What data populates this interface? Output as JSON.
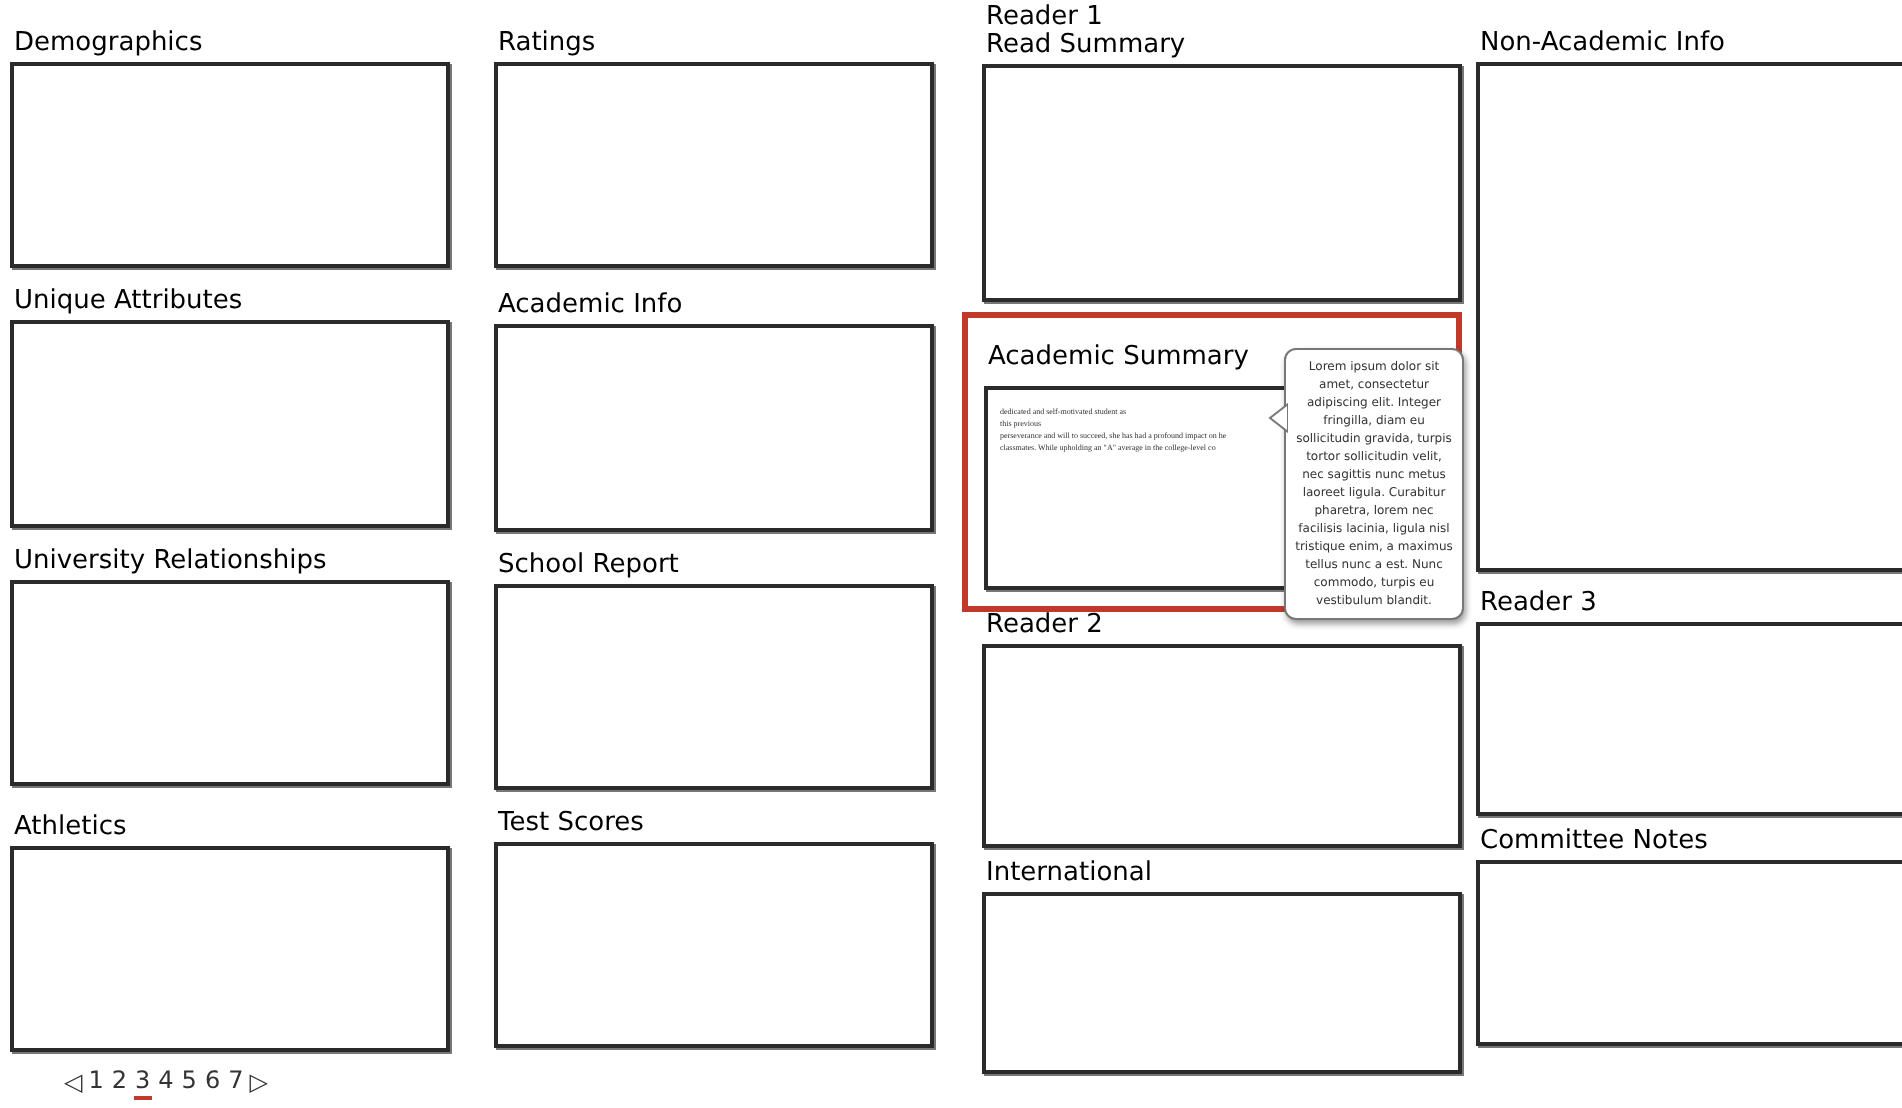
{
  "columns": [
    {
      "panels": [
        {
          "title": [
            "Demographics"
          ]
        },
        {
          "title": [
            "Unique Attributes"
          ]
        },
        {
          "title": [
            "University Relationships"
          ]
        },
        {
          "title": [
            "Athletics"
          ]
        }
      ]
    },
    {
      "panels": [
        {
          "title": [
            "Ratings"
          ]
        },
        {
          "title": [
            "Academic Info"
          ]
        },
        {
          "title": [
            "School Report"
          ]
        },
        {
          "title": [
            "Test Scores"
          ]
        }
      ]
    },
    {
      "panels": [
        {
          "title": [
            "Reader 1",
            "Read Summary"
          ]
        },
        {
          "title": [
            "Academic Summary"
          ],
          "selected": true,
          "snippet": [
            "dedicated and self-motivated student as",
            "this previous",
            "perseverance and will to succeed, she has had a profound impact on he",
            "classmates. While upholding an \"A\" average in the college-level co"
          ],
          "tooltip": "Lorem ipsum dolor sit amet, consectetur adipiscing elit. Integer fringilla, diam eu sollicitudin gravida, turpis tortor sollicitudin velit, nec sagittis nunc metus laoreet ligula. Curabitur pharetra, lorem nec facilisis lacinia, ligula nisl tristique enim, a maximus tellus nunc a est. Nunc commodo, turpis eu vestibulum blandit."
        },
        {
          "title": [
            "Reader 2"
          ]
        },
        {
          "title": [
            "International"
          ]
        }
      ]
    },
    {
      "panels": [
        {
          "title": [
            "Non-Academic Info"
          ]
        },
        {
          "title": [
            "Reader 3"
          ]
        },
        {
          "title": [
            "Committee Notes"
          ]
        }
      ]
    }
  ],
  "pagination": {
    "prev": "◁",
    "next": "▷",
    "pages": [
      {
        "label": "1",
        "selected": false
      },
      {
        "label": "2",
        "selected": false
      },
      {
        "label": "3",
        "selected": true
      },
      {
        "label": "4",
        "selected": false
      },
      {
        "label": "5",
        "selected": false
      },
      {
        "label": "6",
        "selected": false
      },
      {
        "label": "7",
        "selected": false
      }
    ]
  }
}
